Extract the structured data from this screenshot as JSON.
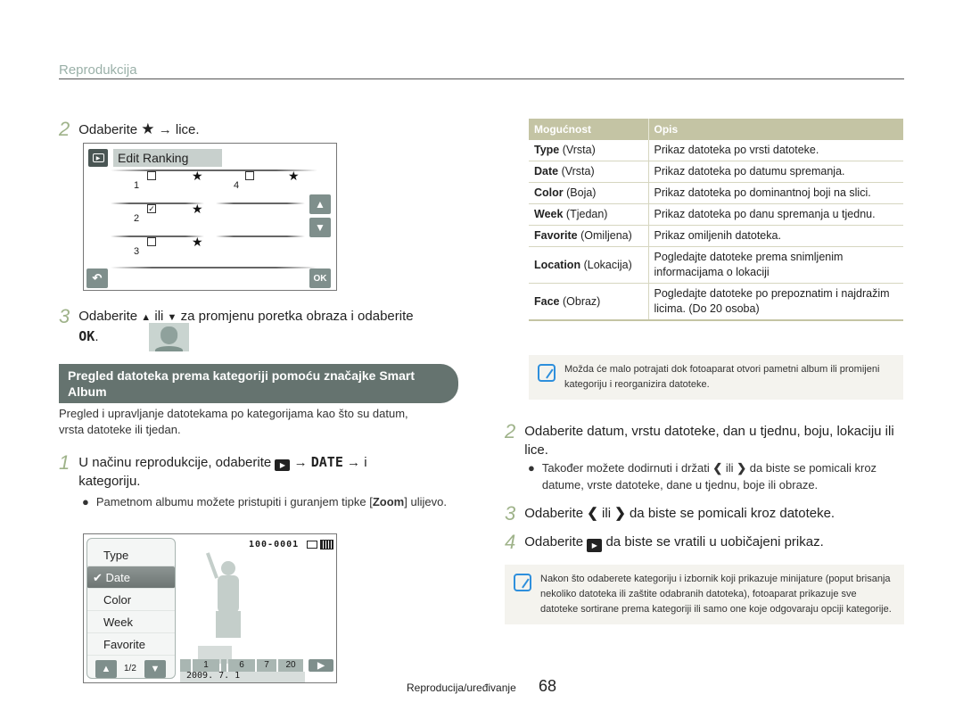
{
  "header": {
    "section": "Reprodukcija"
  },
  "left": {
    "step2": {
      "num": "2",
      "pre": "Odaberite",
      "post": "→ lice."
    },
    "edit_ranking": {
      "title": "Edit Ranking",
      "items": [
        {
          "rank": "1",
          "checked": false,
          "star": "★"
        },
        {
          "rank": "2",
          "checked": true,
          "star": "★"
        },
        {
          "rank": "3",
          "checked": false,
          "star": "★"
        },
        {
          "rank": "4",
          "checked": false,
          "star": "★"
        }
      ],
      "ok_label": "OK",
      "up": "⌃",
      "down": "⌄",
      "back": "↶"
    },
    "step3": {
      "num": "3",
      "pre": "Odaberite",
      "mid": "ili",
      "post": "za promjenu poretka obraza i odaberite",
      "ok": "OK",
      "end": "."
    },
    "section_pill": "Pregled datoteka prema kategoriji pomoću značajke Smart Album",
    "section_desc": "Pregled i upravljanje datotekama po kategorijama kao što su datum, vrsta datoteke ili tjedan.",
    "step1": {
      "num": "1",
      "pre": "U načinu reprodukcije, odaberite",
      "arrow1": "→",
      "date": "DATE",
      "arrow2": "→ i",
      "post": "kategoriju."
    },
    "bullet1": {
      "pre": "Pametnom albumu možete pristupiti i guranjem tipke [",
      "bold": "Zoom",
      "post": "] ulijevo."
    },
    "smart_album": {
      "file_number": "100-0001",
      "menu": [
        "Type",
        "Date",
        "Color",
        "Week",
        "Favorite"
      ],
      "selected": "Date",
      "page": "1/2",
      "dates": [
        "1",
        "6",
        "7",
        "20"
      ],
      "date_label": "2009. 7. 1"
    }
  },
  "right": {
    "table": {
      "headers": [
        "Mogućnost",
        "Opis"
      ],
      "rows": [
        {
          "key": "Type",
          "paren": "(Vrsta)",
          "desc": "Prikaz datoteka po vrsti datoteke."
        },
        {
          "key": "Date",
          "paren": "(Vrsta)",
          "desc": "Prikaz datoteka po datumu spremanja."
        },
        {
          "key": "Color",
          "paren": "(Boja)",
          "desc": "Prikaz datoteka po dominantnoj boji na slici."
        },
        {
          "key": "Week",
          "paren": "(Tjedan)",
          "desc": "Prikaz datoteka po danu spremanja u tjednu."
        },
        {
          "key": "Favorite",
          "paren": "(Omiljena)",
          "desc": "Prikaz omiljenih datoteka."
        },
        {
          "key": "Location",
          "paren": "(Lokacija)",
          "desc": "Pogledajte datoteke prema snimljenim informacijama o lokaciji"
        },
        {
          "key": "Face",
          "paren": "(Obraz)",
          "desc": "Pogledajte datoteke po prepoznatim i najdražim licima. (Do 20 osoba)"
        }
      ]
    },
    "note1": "Možda će malo potrajati dok fotoaparat otvori pametni album ili promijeni kategoriju i reorganizira datoteke.",
    "step2": {
      "num": "2",
      "text": "Odaberite datum, vrstu datoteke, dan u tjednu, boju, lokaciju ili lice."
    },
    "bullet2": {
      "pre": "Također možete dodirnuti i držati",
      "mid": "ili",
      "post": "da biste se pomicali kroz datume, vrste datoteke, dane u tjednu, boje ili obraze."
    },
    "step3": {
      "num": "3",
      "pre": "Odaberite",
      "mid": "ili",
      "post": "da biste se pomicali kroz datoteke."
    },
    "step4": {
      "num": "4",
      "pre": "Odaberite",
      "post": "da biste se vratili u uobičajeni prikaz."
    },
    "note2": "Nakon što odaberete kategoriju i izbornik koji prikazuje minijature (poput brisanja nekoliko datoteka ili zaštite odabranih datoteka), fotoaparat prikazuje sve datoteke sortirane prema kategoriji ili samo one koje odgovaraju opciji kategorije."
  },
  "footer": {
    "label": "Reproducija/uređivanje",
    "page": "68"
  }
}
